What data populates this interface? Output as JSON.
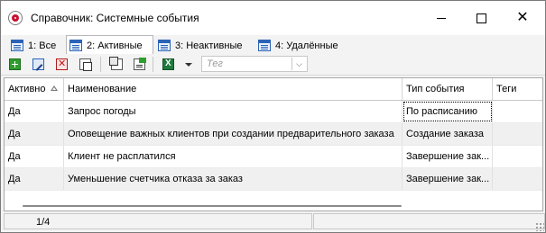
{
  "window": {
    "title": "Справочник: Системные события",
    "controls": {
      "minimize": "—",
      "maximize": "☐",
      "close": "✕"
    }
  },
  "tabs": [
    {
      "label": "1: Все",
      "active": false,
      "icon": "grid-icon"
    },
    {
      "label": "2: Активные",
      "active": true,
      "icon": "grid-icon"
    },
    {
      "label": "3: Неактивные",
      "active": false,
      "icon": "grid-icon"
    },
    {
      "label": "4: Удалённые",
      "active": false,
      "icon": "grid-icon"
    }
  ],
  "toolbar": {
    "buttons": [
      {
        "name": "add-icon"
      },
      {
        "name": "edit-icon"
      },
      {
        "name": "delete-icon"
      },
      {
        "name": "copy-icon"
      },
      {
        "name": "duplicate-icon"
      },
      {
        "name": "properties-icon"
      },
      {
        "name": "excel-export-icon"
      }
    ],
    "tag_filter": {
      "placeholder": "Тег",
      "value": ""
    }
  },
  "grid": {
    "columns": [
      "Активно",
      "Наименование",
      "Тип события",
      "Теги"
    ],
    "sort_column": "Активно",
    "rows": [
      [
        "Да",
        "Запрос погоды",
        "По расписанию",
        ""
      ],
      [
        "Да",
        "Оповещение важных клиентов при создании предварительного заказа",
        "Создание заказа",
        ""
      ],
      [
        "Да",
        "Клиент не расплатился",
        "Завершение зак...",
        ""
      ],
      [
        "Да",
        "Уменьшение счетчика отказа за заказ",
        "Завершение зак...",
        ""
      ]
    ]
  },
  "status": {
    "record_position": "1/4"
  },
  "colors": {
    "row_alt": "#f0f0f0",
    "accent": "#2a63b8",
    "brand": "#c8102e"
  }
}
